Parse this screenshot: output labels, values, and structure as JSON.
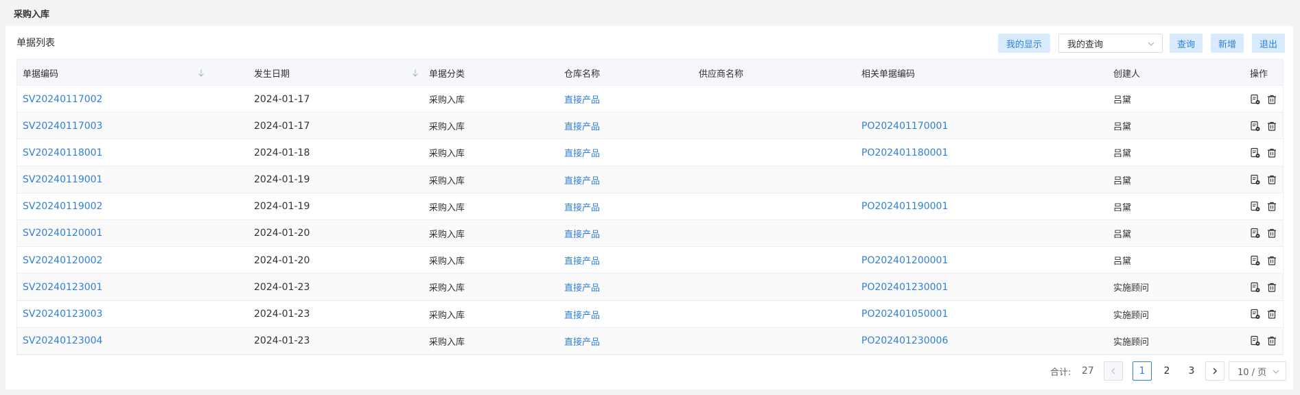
{
  "page": {
    "title": "采购入库"
  },
  "toolbar": {
    "list_title": "单据列表",
    "display_label": "我的显示",
    "query_select_value": "我的查询",
    "query_label": "查询",
    "add_label": "新增",
    "exit_label": "退出"
  },
  "table": {
    "columns": [
      "单据编码",
      "发生日期",
      "单据分类",
      "仓库名称",
      "供应商名称",
      "相关单据编码",
      "创建人",
      "操作"
    ],
    "rows": [
      {
        "code": "SV20240117002",
        "date": "2024-01-17",
        "type": "采购入库",
        "warehouse": "直接产品",
        "supplier": "",
        "related": "",
        "creator": "吕黛"
      },
      {
        "code": "SV20240117003",
        "date": "2024-01-17",
        "type": "采购入库",
        "warehouse": "直接产品",
        "supplier": "",
        "related": "PO202401170001",
        "creator": "吕黛"
      },
      {
        "code": "SV20240118001",
        "date": "2024-01-18",
        "type": "采购入库",
        "warehouse": "直接产品",
        "supplier": "",
        "related": "PO202401180001",
        "creator": "吕黛"
      },
      {
        "code": "SV20240119001",
        "date": "2024-01-19",
        "type": "采购入库",
        "warehouse": "直接产品",
        "supplier": "",
        "related": "",
        "creator": "吕黛"
      },
      {
        "code": "SV20240119002",
        "date": "2024-01-19",
        "type": "采购入库",
        "warehouse": "直接产品",
        "supplier": "",
        "related": "PO202401190001",
        "creator": "吕黛"
      },
      {
        "code": "SV20240120001",
        "date": "2024-01-20",
        "type": "采购入库",
        "warehouse": "直接产品",
        "supplier": "",
        "related": "",
        "creator": "吕黛"
      },
      {
        "code": "SV20240120002",
        "date": "2024-01-20",
        "type": "采购入库",
        "warehouse": "直接产品",
        "supplier": "",
        "related": "PO202401200001",
        "creator": "吕黛"
      },
      {
        "code": "SV20240123001",
        "date": "2024-01-23",
        "type": "采购入库",
        "warehouse": "直接产品",
        "supplier": "",
        "related": "PO202401230001",
        "creator": "实施顾问"
      },
      {
        "code": "SV20240123003",
        "date": "2024-01-23",
        "type": "采购入库",
        "warehouse": "直接产品",
        "supplier": "",
        "related": "PO202401050001",
        "creator": "实施顾问"
      },
      {
        "code": "SV20240123004",
        "date": "2024-01-23",
        "type": "采购入库",
        "warehouse": "直接产品",
        "supplier": "",
        "related": "PO202401230006",
        "creator": "实施顾问"
      }
    ],
    "row_icons": [
      "view-doc-icon",
      "trash-icon"
    ]
  },
  "pagination": {
    "total_label": "合计:",
    "total": "27",
    "pages": [
      "1",
      "2",
      "3"
    ],
    "current_page": "1",
    "page_size_label": "10 / 页"
  },
  "colors": {
    "accent": "#2f7fd8",
    "button_bg": "#d9ecff",
    "header_bg": "#f5f7fa",
    "page_bg": "#f2f3f5"
  }
}
